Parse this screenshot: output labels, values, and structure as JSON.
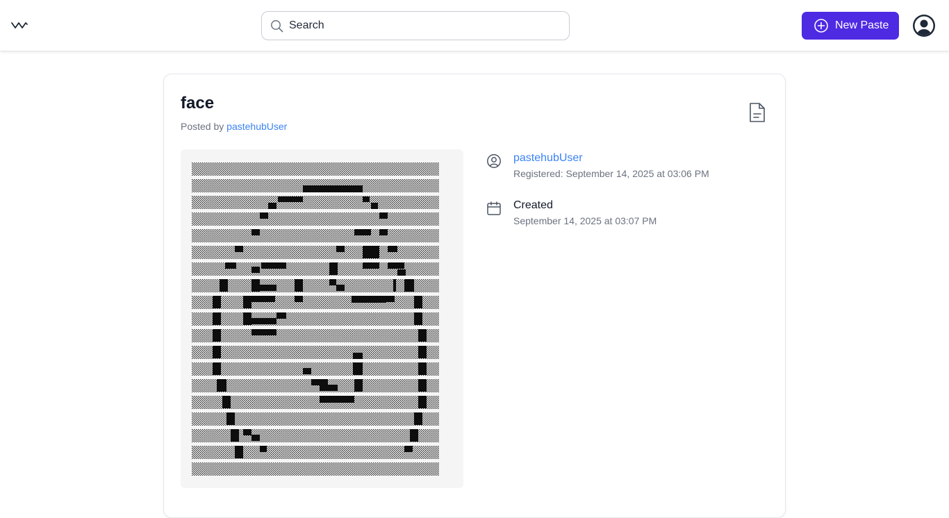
{
  "header": {
    "search_placeholder": "Search",
    "new_paste_label": "New Paste",
    "accent_color": "#4f2ae3"
  },
  "paste": {
    "title": "face",
    "posted_by_prefix": "Posted by",
    "author": "pastehubUser",
    "content_description": "ASCII art drawing of a face rendered with dotted shading and solid block characters"
  },
  "sidebar_meta": {
    "author": "pastehubUser",
    "registered": "Registered: September 14, 2025 at 03:06 PM",
    "created_label": "Created",
    "created_date": "September 14, 2025 at 03:07 PM"
  },
  "icons": [
    "logo-wave-icon",
    "search-icon",
    "plus-circle-icon",
    "user-avatar-icon",
    "document-icon",
    "user-circle-icon",
    "calendar-icon"
  ],
  "link_color": "#3b82f6"
}
